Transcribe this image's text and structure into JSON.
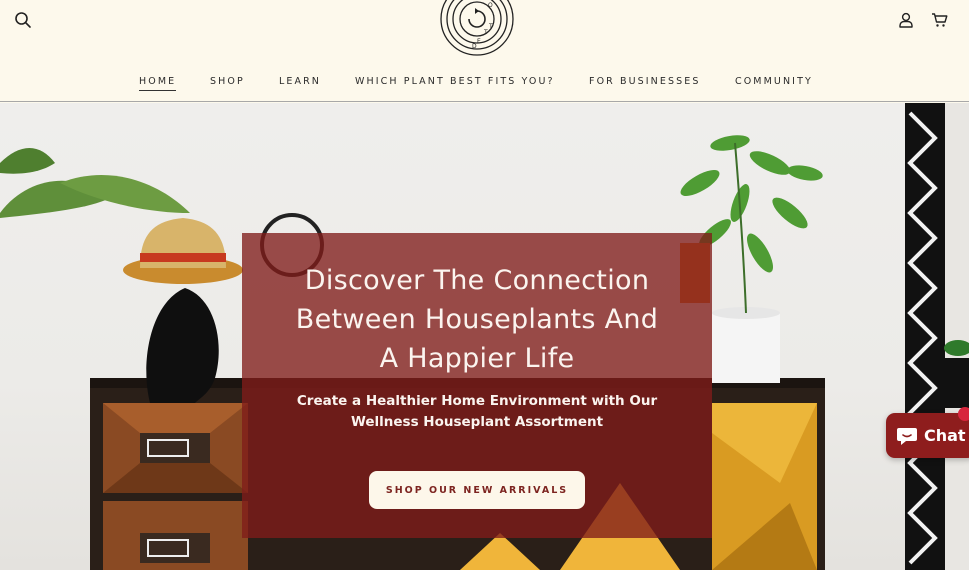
{
  "header": {
    "logo_alt": "Rooted",
    "logo_letters": [
      "R",
      "O",
      "O",
      "T",
      "E",
      "D"
    ],
    "icons": {
      "search": "search-icon",
      "account": "account-icon",
      "cart": "cart-icon"
    }
  },
  "nav": {
    "items": [
      {
        "label": "HOME"
      },
      {
        "label": "SHOP"
      },
      {
        "label": "LEARN"
      },
      {
        "label": "WHICH PLANT BEST FITS YOU?"
      },
      {
        "label": "FOR BUSINESSES"
      },
      {
        "label": "COMMUNITY"
      }
    ]
  },
  "hero": {
    "title_lines": [
      "Discover The Connection",
      "Between Houseplants And",
      "A Happier Life"
    ],
    "subtitle_lines": [
      "Create a Healthier Home Environment with Our",
      "Wellness Houseplant Assortment"
    ],
    "cta_label": "SHOP OUR NEW ARRIVALS"
  },
  "chat": {
    "label": "Chat",
    "icon": "chat-bubble-icon"
  },
  "colors": {
    "background": "#fdf9ec",
    "overlay": "#801c1a",
    "accent": "#8e1d1d",
    "text": "#2b2b2b"
  }
}
